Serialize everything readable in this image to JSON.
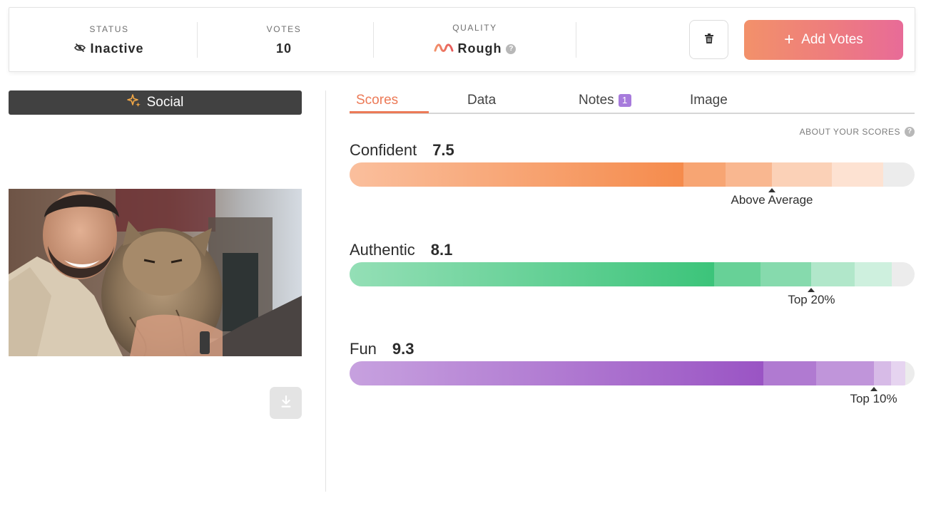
{
  "stats": {
    "status": {
      "label": "STATUS",
      "value": "Inactive",
      "icon": "eye-off-icon"
    },
    "votes": {
      "label": "VOTES",
      "value": "10"
    },
    "quality": {
      "label": "QUALITY",
      "value": "Rough",
      "icon": "wave-icon",
      "help": "?"
    }
  },
  "actions": {
    "add_label": "Add Votes",
    "add_icon": "+",
    "delete_icon": "trash-icon"
  },
  "category": {
    "label": "Social",
    "icon": "sparkle-icon"
  },
  "tabs": [
    {
      "label": "Scores",
      "active": true
    },
    {
      "label": "Data",
      "active": false
    },
    {
      "label": "Notes",
      "badge": "1",
      "active": false
    },
    {
      "label": "Image",
      "active": false
    }
  ],
  "about_scores": {
    "label": "ABOUT YOUR SCORES",
    "help": "?"
  },
  "scores": [
    {
      "name": "Confident",
      "value": "7.5",
      "rank": "Above Average",
      "percentile": 75,
      "color": "#f58b4c"
    },
    {
      "name": "Authentic",
      "value": "8.1",
      "rank": "Top 20%",
      "percentile": 82,
      "color": "#3cc47a"
    },
    {
      "name": "Fun",
      "value": "9.3",
      "rank": "Top 10%",
      "percentile": 93,
      "color": "#9a54c4"
    }
  ],
  "colors": {
    "accent": "#ec7a57",
    "badge": "#a77bdc"
  }
}
